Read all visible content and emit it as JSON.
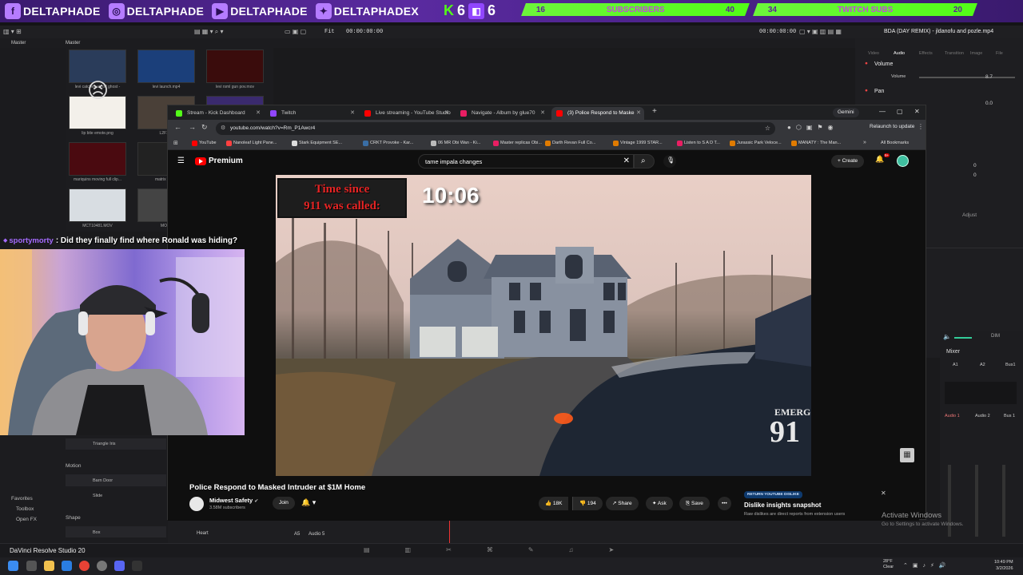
{
  "overlay": {
    "social": [
      {
        "icon": "facebook-icon",
        "glyph": "f",
        "name": "DELTAPHADE"
      },
      {
        "icon": "instagram-icon",
        "glyph": "◎",
        "name": "DELTAPHADE"
      },
      {
        "icon": "youtube-icon",
        "glyph": "▶",
        "name": "DELTAPHADE"
      },
      {
        "icon": "twitter-icon",
        "glyph": "✦",
        "name": "DELTAPHADEX"
      }
    ],
    "kick_logo": "K",
    "kick_count": "6",
    "twitch_count": "6",
    "subs_goal": {
      "current": "16",
      "label": "SUBSCRIBERS",
      "target": "40"
    },
    "twitch_goal": {
      "current": "34",
      "label": "TWITCH SUBS",
      "target": "20"
    },
    "accent": "#53fc18",
    "bg": "#4a2290"
  },
  "resolve": {
    "left_panel": "Master",
    "media_panel": "Master",
    "timecode_left": "00:00:00:00",
    "fit_label": "Fit",
    "timecode_right": "00:00:00:00",
    "filename": "BDA (DAY REMIX) - jldanofu and pozle.mp4",
    "inspector_tabs": [
      "Video",
      "Audio",
      "Effects",
      "Transition",
      "Image",
      "File"
    ],
    "volume_label": "Volume",
    "volume_sub": "Volume",
    "volume_value": "8.7",
    "pan_label": "Pan",
    "pan_value": "0.0",
    "val_a": "0",
    "val_b": "0",
    "adjust": "Adjust",
    "thumbs": [
      {
        "cap": "levi catches air off ghost -"
      },
      {
        "cap": "levi launch.mp4"
      },
      {
        "cap": "levi rsml gun pov.mov"
      },
      {
        "cap": "lip bite emote.png"
      },
      {
        "cap": "L2F1_1"
      },
      {
        "cap": ""
      },
      {
        "cap": "mariquins moving full clip..."
      },
      {
        "cap": "matrix music"
      },
      {
        "cap": ""
      },
      {
        "cap": "MCT10481.MOV"
      },
      {
        "cap": "MOB0"
      },
      {
        "cap": ""
      }
    ],
    "left_items": {
      "triangle": "Triangle Iris",
      "motion": "Motion",
      "barn_door": "Barn Door",
      "slide": "Slide",
      "shape": "Shape",
      "box": "Box",
      "heart": "Heart",
      "favorites": "Favorites",
      "toolbox": "Toolbox",
      "openfx": "Open FX"
    },
    "track_label": "Audio 5",
    "track_code": "A5",
    "mixer": {
      "title": "Mixer",
      "cols": [
        "A1",
        "A2",
        "Bus1"
      ],
      "tracks": [
        "Audio 1",
        "Audio 2",
        "Bus 1"
      ],
      "dim": "DIM"
    },
    "brand": "DaVinci Resolve Studio 20"
  },
  "browser": {
    "tabs": [
      {
        "label": "Stream - Kick Dashboard",
        "color": "#53fc18"
      },
      {
        "label": "Twitch",
        "color": "#9146ff"
      },
      {
        "label": "Live streaming - YouTube Studio",
        "color": "#ff0000"
      },
      {
        "label": "Navigate - Album by glue70",
        "color": "#e91e63"
      },
      {
        "label": "(3) Police Respond to Maske",
        "color": "#ff0000"
      }
    ],
    "gemini": "Gemini",
    "url": "youtube.com/watch?v=Rm_P1Awcr4",
    "relaunch": "Relaunch to update",
    "bookmarks": [
      {
        "label": "YouTube",
        "color": "#ff0000"
      },
      {
        "label": "Nanoleaf Light Pane...",
        "color": "#ff4040"
      },
      {
        "label": "Stark Equipment SE...",
        "color": "#dddddd"
      },
      {
        "label": "CRKT Provoke - Kar...",
        "color": "#3a6ea5"
      },
      {
        "label": "06 MR Obi Wan - Ki...",
        "color": "#bbbbbb"
      },
      {
        "label": "Master replicas Obi...",
        "color": "#e91e63"
      },
      {
        "label": "Darth Revan Full Co...",
        "color": "#e07b00"
      },
      {
        "label": "Vintage 1999 STAR...",
        "color": "#e07b00"
      },
      {
        "label": "Listen to S A D T...",
        "color": "#e91e63"
      },
      {
        "label": "Jurassic Park Veloce...",
        "color": "#e07b00"
      },
      {
        "label": "MANATY : The Man...",
        "color": "#e07b00"
      }
    ],
    "all_bookmarks": "All Bookmarks"
  },
  "youtube": {
    "logo": "Premium",
    "search": "tame impala changes",
    "create": "Create",
    "notif_count": "9+",
    "overlay_line1": "Time since",
    "overlay_line2": "911 was called:",
    "overlay_time": "10:06",
    "car_text1": "EMERG",
    "car_text2": "91",
    "title": "Police Respond to Masked Intruder at $1M Home",
    "channel": "Midwest Safety",
    "subs": "3.58M subscribers",
    "join": "Join",
    "likes": "18K",
    "dislikes": "194",
    "share": "Share",
    "ask": "Ask",
    "save": "Save",
    "more": "•••",
    "dislike_badge": "RETURN YOUTUBE DISLIKE",
    "dislike_title": "Dislike insights snapshot",
    "dislike_sub": "Raw dislikes are direct reports from extension users"
  },
  "chat": {
    "user": "sportymorty",
    "message": ": Did they finally find where Ronald was hiding?"
  },
  "windows": {
    "activate_title": "Activate Windows",
    "activate_sub": "Go to Settings to activate Windows.",
    "temp": "28°F",
    "weather": "Clear",
    "time": "10:49 PM",
    "date": "3/2/2026"
  }
}
